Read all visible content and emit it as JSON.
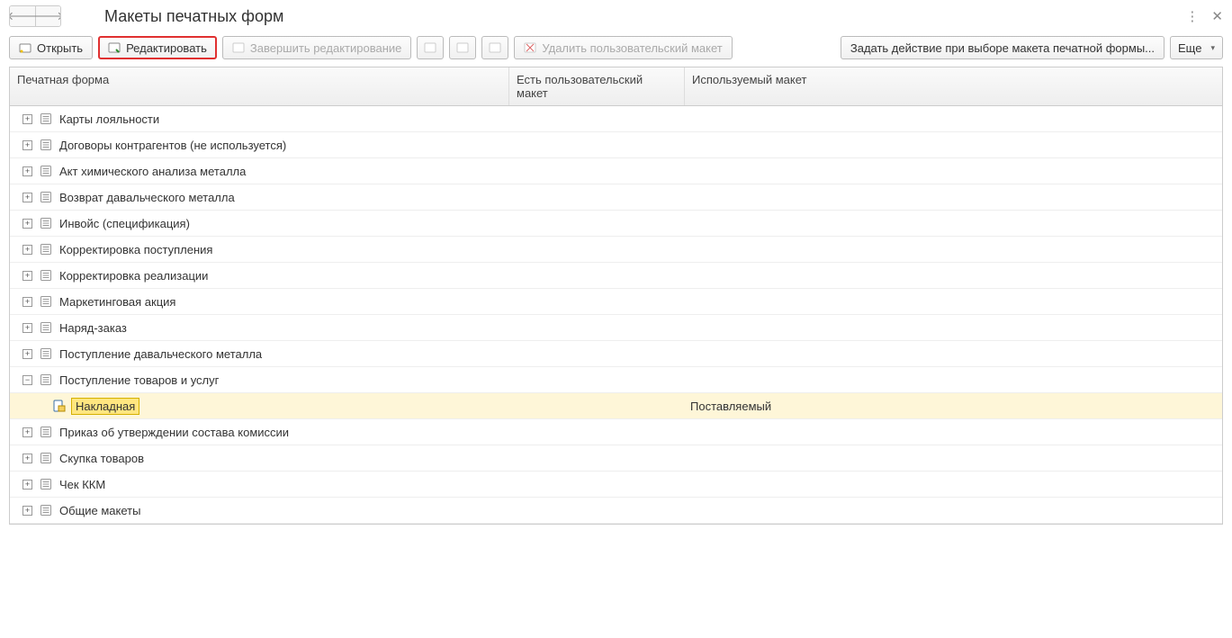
{
  "page_title": "Макеты печатных форм",
  "toolbar": {
    "open": "Открыть",
    "edit": "Редактировать",
    "finish_edit": "Завершить редактирование",
    "delete_user": "Удалить пользовательский макет",
    "set_action": "Задать действие при выборе макета печатной формы...",
    "more": "Еще"
  },
  "columns": {
    "c1": "Печатная форма",
    "c2": "Есть пользовательский макет",
    "c3": "Используемый макет"
  },
  "rows": [
    {
      "label": "Карты лояльности",
      "expander": "+"
    },
    {
      "label": "Договоры контрагентов (не используется)",
      "expander": "+"
    },
    {
      "label": "Акт химического анализа металла",
      "expander": "+"
    },
    {
      "label": "Возврат давальческого металла",
      "expander": "+"
    },
    {
      "label": "Инвойс (спецификация)",
      "expander": "+"
    },
    {
      "label": "Корректировка поступления",
      "expander": "+"
    },
    {
      "label": "Корректировка реализации",
      "expander": "+"
    },
    {
      "label": "Маркетинговая акция",
      "expander": "+"
    },
    {
      "label": "Наряд-заказ",
      "expander": "+"
    },
    {
      "label": "Поступление давальческого металла",
      "expander": "+"
    },
    {
      "label": "Поступление товаров и услуг",
      "expander": "−"
    },
    {
      "label": "Накладная",
      "child": true,
      "selected": true,
      "used": "Поставляемый"
    },
    {
      "label": "Приказ об утверждении состава комиссии",
      "expander": "+"
    },
    {
      "label": "Скупка товаров",
      "expander": "+"
    },
    {
      "label": "Чек ККМ",
      "expander": "+"
    },
    {
      "label": "Общие макеты",
      "expander": "+"
    }
  ]
}
